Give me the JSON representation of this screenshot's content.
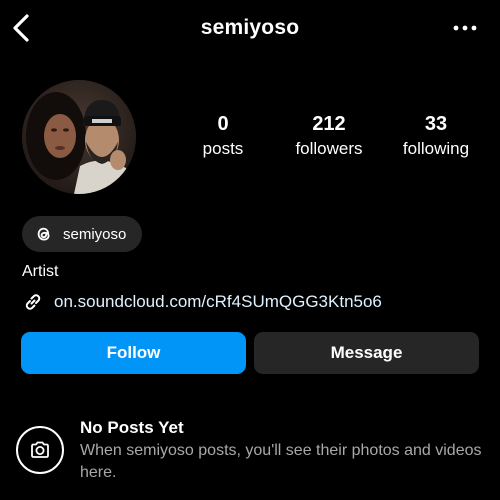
{
  "header": {
    "title": "semiyoso",
    "back_icon": "chevron-left-icon",
    "more_icon": "more-horizontal-icon"
  },
  "profile": {
    "avatar_icon": "profile-photo"
  },
  "stats": {
    "posts": {
      "count": "0",
      "label": "posts"
    },
    "followers": {
      "count": "212",
      "label": "followers"
    },
    "following": {
      "count": "33",
      "label": "following"
    }
  },
  "threads": {
    "icon": "threads-icon",
    "label": "semiyoso"
  },
  "bio": {
    "category": "Artist",
    "link_icon": "link-icon",
    "link": "on.soundcloud.com/cRf4SUmQGG3Ktn5o6"
  },
  "actions": {
    "follow_label": "Follow",
    "message_label": "Message"
  },
  "empty_state": {
    "icon": "camera-icon",
    "title": "No Posts Yet",
    "description": "When semiyoso posts, you'll see their photos and videos here."
  },
  "colors": {
    "background": "#000000",
    "follow_button": "#0095f6",
    "secondary_button": "#262626",
    "muted_text": "#a8a8a8"
  }
}
